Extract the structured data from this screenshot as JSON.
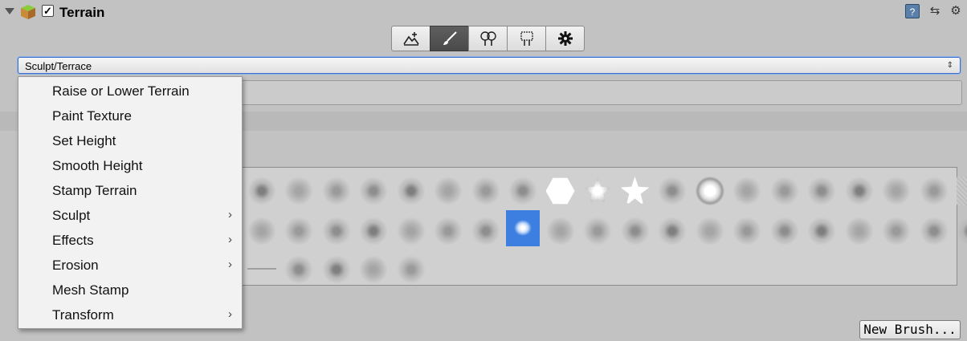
{
  "component": {
    "title": "Terrain",
    "enabled_mark": "✓",
    "icons": {
      "help": "?",
      "preset": "⇆",
      "settings": "⚙"
    }
  },
  "toolbar": {
    "tools": [
      {
        "name": "create-neighbor-terrains",
        "icon": "mountain-plus-icon",
        "active": false
      },
      {
        "name": "paint-terrain",
        "icon": "brush-icon",
        "active": true
      },
      {
        "name": "paint-trees",
        "icon": "trees-icon",
        "active": false
      },
      {
        "name": "paint-details",
        "icon": "details-icon",
        "active": false
      },
      {
        "name": "terrain-settings",
        "icon": "gear-icon",
        "active": false
      }
    ]
  },
  "tool_select": {
    "value": "Sculpt/Terrace",
    "arrow": "⇕"
  },
  "menu": {
    "items": [
      {
        "label": "Raise or Lower Terrain",
        "submenu": false
      },
      {
        "label": "Paint Texture",
        "submenu": false
      },
      {
        "label": "Set Height",
        "submenu": false
      },
      {
        "label": "Smooth Height",
        "submenu": false
      },
      {
        "label": "Stamp Terrain",
        "submenu": false
      },
      {
        "label": "Sculpt",
        "submenu": true
      },
      {
        "label": "Effects",
        "submenu": true
      },
      {
        "label": "Erosion",
        "submenu": true
      },
      {
        "label": "Mesh Stamp",
        "submenu": false
      },
      {
        "label": "Transform",
        "submenu": true
      }
    ],
    "chevron": "›"
  },
  "brushes": {
    "selected_row": 2,
    "selected_col": 8
  },
  "new_brush_button": "New Brush..."
}
